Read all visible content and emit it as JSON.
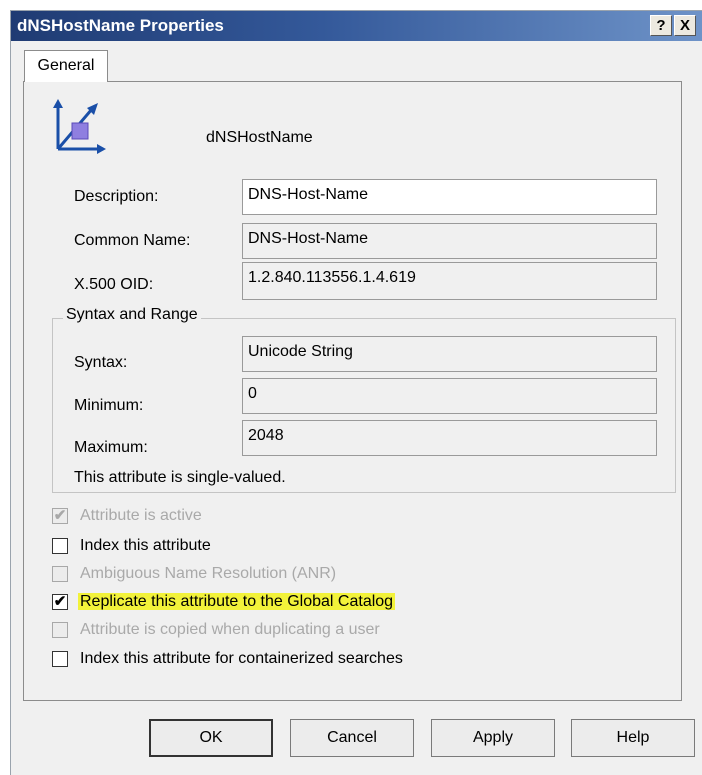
{
  "window": {
    "title": "dNSHostName Properties",
    "help_glyph": "?",
    "close_glyph": "X"
  },
  "tabs": [
    {
      "label": "General"
    }
  ],
  "general": {
    "attribute_name": "dNSHostName",
    "description_label": "Description:",
    "description_value": "DNS-Host-Name",
    "common_name_label": "Common Name:",
    "common_name_value": "DNS-Host-Name",
    "oid_label": "X.500 OID:",
    "oid_value": "1.2.840.113556.1.4.619",
    "syntax_group": {
      "title": "Syntax and Range",
      "syntax_label": "Syntax:",
      "syntax_value": "Unicode String",
      "minimum_label": "Minimum:",
      "minimum_value": "0",
      "maximum_label": "Maximum:",
      "maximum_value": "2048",
      "note": "This attribute is single-valued."
    },
    "options": [
      {
        "label": "Attribute is active",
        "checked": true,
        "enabled": false
      },
      {
        "label": "Index this attribute",
        "checked": false,
        "enabled": true
      },
      {
        "label": "Ambiguous Name Resolution (ANR)",
        "checked": false,
        "enabled": false
      },
      {
        "label": "Replicate this attribute to the Global Catalog",
        "checked": true,
        "enabled": true,
        "highlight_color": "#f2f23a"
      },
      {
        "label": "Attribute is copied when duplicating a user",
        "checked": false,
        "enabled": false
      },
      {
        "label": "Index this attribute for containerized searches",
        "checked": false,
        "enabled": true
      }
    ]
  },
  "buttons": {
    "ok": "OK",
    "cancel": "Cancel",
    "apply": "Apply",
    "help": "Help"
  },
  "check_glyph": "✔",
  "icons": {
    "attribute": "attribute-icon"
  },
  "colors": {
    "title_bar_start": "#1f3b73",
    "title_bar_end": "#6e93c8",
    "dialog_bg": "#f0f0f0",
    "highlight": "#f2f23a"
  }
}
